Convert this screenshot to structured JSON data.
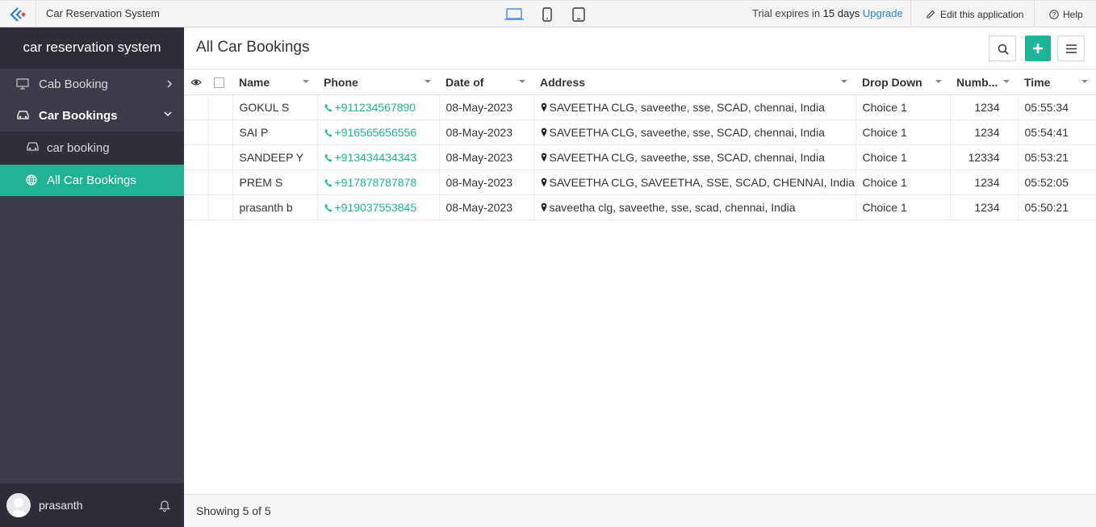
{
  "topbar": {
    "app_title": "Car Reservation System",
    "devices": [
      "laptop-icon",
      "phone-icon",
      "tablet-icon"
    ],
    "active_device": "laptop",
    "trial_prefix": "Trial expires in",
    "trial_days": "15 days",
    "upgrade_label": "Upgrade",
    "edit_label": "Edit this application",
    "help_label": "Help"
  },
  "sidebar": {
    "title": "car reservation system",
    "items": [
      {
        "label": "Cab Booking",
        "icon": "monitor-icon",
        "chevron": "right"
      },
      {
        "label": "Car Bookings",
        "icon": "car-icon",
        "chevron": "down"
      },
      {
        "label": "car booking",
        "icon": "car-icon"
      },
      {
        "label": "All Car Bookings",
        "icon": "globe-icon",
        "active": true
      }
    ],
    "user_name": "prasanth"
  },
  "main": {
    "title": "All Car Bookings",
    "columns": [
      "Name",
      "Phone",
      "Date of",
      "Address",
      "Drop Down",
      "Numb...",
      "Time"
    ],
    "rows": [
      {
        "name": "GOKUL S",
        "phone": "+911234567890",
        "date": "08-May-2023",
        "address": "SAVEETHA CLG, saveethe, sse, SCAD, chennai, India",
        "dropdown": "Choice 1",
        "number": "1234",
        "time": "05:55:34"
      },
      {
        "name": "SAI P",
        "phone": "+916565656556",
        "date": "08-May-2023",
        "address": "SAVEETHA CLG, saveethe, sse, SCAD, chennai, India",
        "dropdown": "Choice 1",
        "number": "1234",
        "time": "05:54:41"
      },
      {
        "name": "SANDEEP Y",
        "phone": "+913434434343",
        "date": "08-May-2023",
        "address": "SAVEETHA CLG, saveethe, sse, SCAD, chennai, India",
        "dropdown": "Choice 1",
        "number": "12334",
        "time": "05:53:21"
      },
      {
        "name": "PREM S",
        "phone": "+917878787878",
        "date": "08-May-2023",
        "address": "SAVEETHA CLG, SAVEETHA, SSE, SCAD, CHENNAI, India",
        "dropdown": "Choice 1",
        "number": "1234",
        "time": "05:52:05"
      },
      {
        "name": "prasanth b",
        "phone": "+919037553845",
        "date": "08-May-2023",
        "address": "saveetha clg, saveethe, sse, scad, chennai, India",
        "dropdown": "Choice 1",
        "number": "1234",
        "time": "05:50:21"
      }
    ],
    "footer": "Showing 5 of 5"
  },
  "colors": {
    "accent": "#1fb293",
    "sidebar_bg": "#3b3c47",
    "link": "#2d7fd1"
  }
}
